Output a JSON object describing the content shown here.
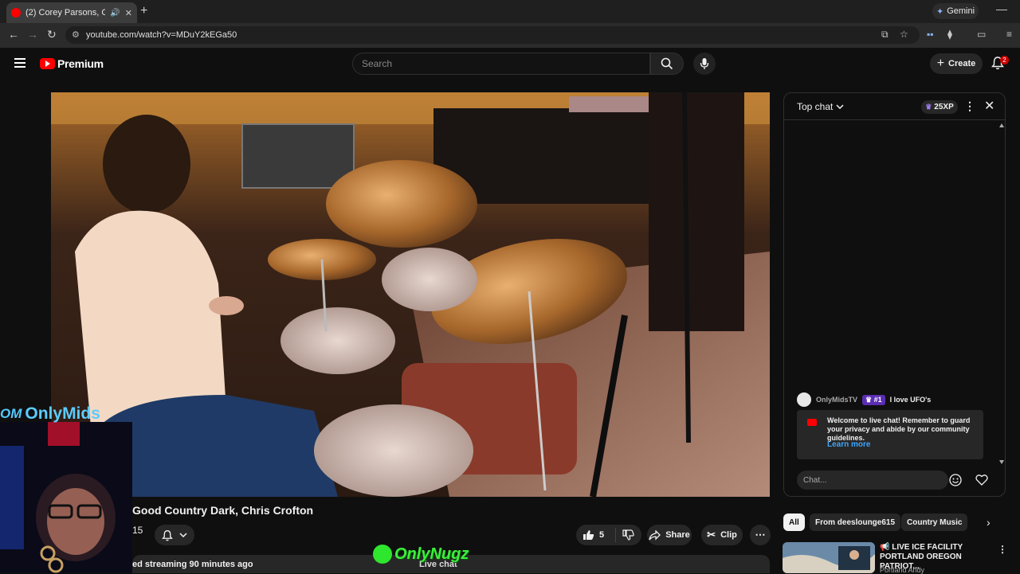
{
  "browser": {
    "tab_title": "(2) Corey Parsons, Good Co",
    "tab_close": "✕",
    "new_tab": "+",
    "gemini_label": "Gemini",
    "minimize": "—",
    "url": "youtube.com/watch?v=MDuY2kEGa50"
  },
  "youtube": {
    "logo_text": "Premium",
    "search_placeholder": "Search",
    "create_label": "Create",
    "notification_count": "2"
  },
  "overlays": {
    "onlymids_badge": "OM",
    "onlymids_text": "OnlyMids",
    "onlynugz_text": "OnlyNugz"
  },
  "video": {
    "title": "Good Country Dark, Chris Crofton",
    "subscriber_fragment": "15",
    "likes": "5",
    "share_label": "Share",
    "clip_label": "Clip",
    "stream_info": "ed streaming 90 minutes ago",
    "live_chat_label": "Live chat"
  },
  "chat": {
    "mode": "Top chat",
    "xp": "25XP",
    "message": {
      "author": "OnlyMidsTV",
      "rank": "#1",
      "text": "I love UFO's"
    },
    "welcome_text": "Welcome to live chat! Remember to guard your privacy and abide by our community guidelines.",
    "learn_more": "Learn more",
    "input_placeholder": "Chat..."
  },
  "chips": [
    "All",
    "From deeslounge615",
    "Country Music"
  ],
  "recommendation": {
    "title": "📢 LIVE ICE FACILITY PORTLAND OREGON PATRIOT...",
    "channel": "Portland Andy"
  },
  "colors": {
    "accent_red": "#ff0000",
    "link_blue": "#3ea6ff",
    "rank_purple": "#5b2db3"
  }
}
